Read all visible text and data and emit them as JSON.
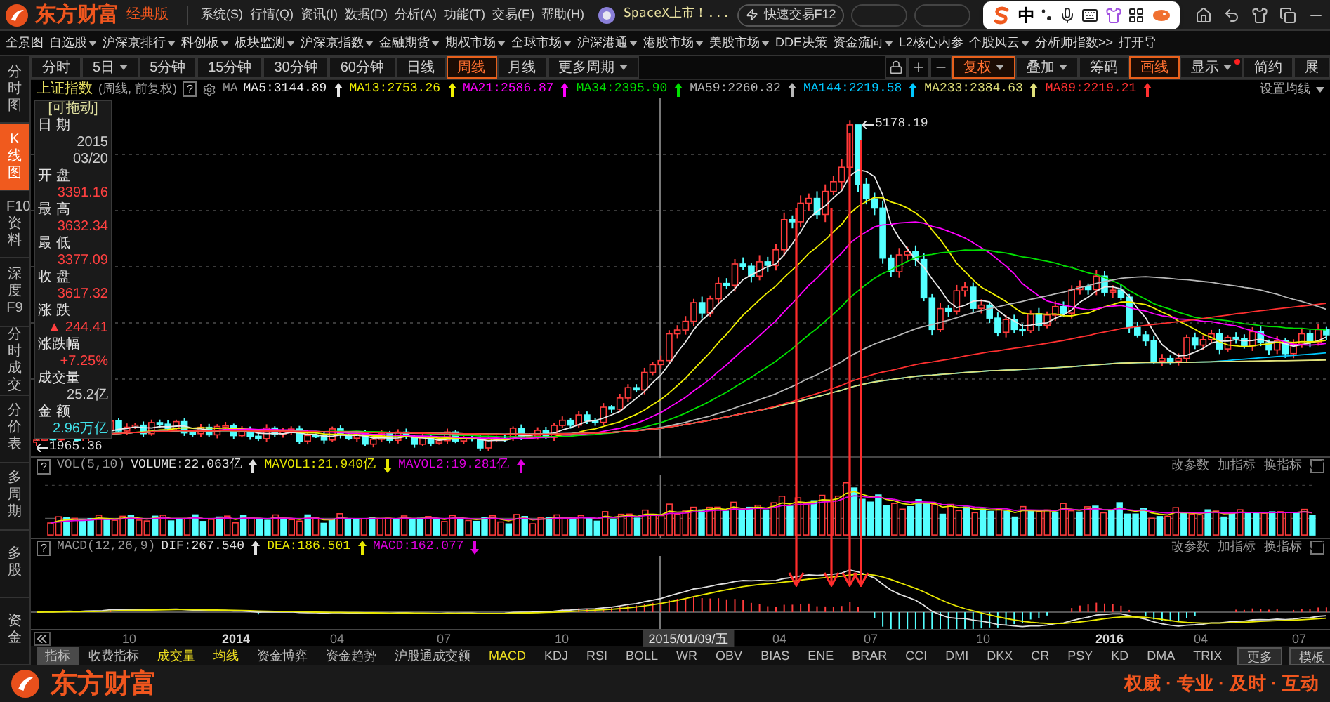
{
  "title_bar": {
    "logo": "东方财富",
    "edition": "经典版",
    "menus": [
      "系统(S)",
      "行情(Q)",
      "资讯(I)",
      "数据(D)",
      "分析(A)",
      "功能(T)",
      "交易(E)",
      "帮助(H)"
    ],
    "news": "SpaceX上市！...",
    "quick_trade": "快速交易F12",
    "ime": {
      "label": "中"
    }
  },
  "nav": [
    {
      "label": "全景图",
      "dropdown": false
    },
    {
      "label": "自选股",
      "dropdown": true
    },
    {
      "label": "沪深京排行",
      "dropdown": true
    },
    {
      "label": "科创板",
      "dropdown": true
    },
    {
      "label": "板块监测",
      "dropdown": true
    },
    {
      "label": "沪深京指数",
      "dropdown": true
    },
    {
      "label": "金融期货",
      "dropdown": true
    },
    {
      "label": "期权市场",
      "dropdown": true
    },
    {
      "label": "全球市场",
      "dropdown": true
    },
    {
      "label": "沪深港通",
      "dropdown": true
    },
    {
      "label": "港股市场",
      "dropdown": true
    },
    {
      "label": "美股市场",
      "dropdown": true
    },
    {
      "label": "DDE决策",
      "dropdown": false
    },
    {
      "label": "资金流向",
      "dropdown": true
    },
    {
      "label": "L2核心内参",
      "dropdown": false
    },
    {
      "label": "个股风云",
      "dropdown": true
    },
    {
      "label": "分析师指数>>",
      "dropdown": false
    },
    {
      "label": "打开导",
      "dropdown": false
    }
  ],
  "sidebar": [
    {
      "label": "分时图",
      "selected": false
    },
    {
      "label": "K线图",
      "selected": true
    },
    {
      "label": "F10资料",
      "selected": false
    },
    {
      "label": "深度F9",
      "selected": false
    },
    {
      "label": "分时成交",
      "selected": false
    },
    {
      "label": "分价表",
      "selected": false
    },
    {
      "label": "多周期",
      "selected": false
    },
    {
      "label": "多股",
      "selected": false
    },
    {
      "label": "资金",
      "selected": false
    }
  ],
  "periods": [
    {
      "label": "分时",
      "dropdown": false,
      "selected": false
    },
    {
      "label": "5日",
      "dropdown": true,
      "selected": false
    },
    {
      "label": "5分钟",
      "dropdown": false,
      "selected": false
    },
    {
      "label": "15分钟",
      "dropdown": false,
      "selected": false
    },
    {
      "label": "30分钟",
      "dropdown": false,
      "selected": false
    },
    {
      "label": "60分钟",
      "dropdown": false,
      "selected": false
    },
    {
      "label": "日线",
      "dropdown": false,
      "selected": false
    },
    {
      "label": "周线",
      "dropdown": false,
      "selected": true
    },
    {
      "label": "月线",
      "dropdown": false,
      "selected": false
    },
    {
      "label": "更多周期",
      "dropdown": true,
      "selected": false
    }
  ],
  "toolbar": [
    {
      "label": "复权",
      "dropdown": true,
      "active": true,
      "dot": false
    },
    {
      "label": "叠加",
      "dropdown": true,
      "active": false,
      "dot": false
    },
    {
      "label": "筹码",
      "dropdown": false,
      "active": false,
      "dot": false
    },
    {
      "label": "画线",
      "dropdown": false,
      "active": true,
      "dot": false
    },
    {
      "label": "显示",
      "dropdown": true,
      "active": false,
      "dot": true
    },
    {
      "label": "简约",
      "dropdown": false,
      "active": false,
      "dot": false
    },
    {
      "label": "展",
      "dropdown": false,
      "active": false,
      "dot": false
    }
  ],
  "legend": {
    "title": "上证指数",
    "subtitle": "(周线, 前复权)",
    "help": "?",
    "ma_prefix": "MA",
    "settings": "设置均线",
    "mas": [
      {
        "label": "MA5:3144.89",
        "color": "#e8e8e8",
        "rising": true
      },
      {
        "label": "MA13:2753.26",
        "color": "#f0f000",
        "rising": true
      },
      {
        "label": "MA21:2586.87",
        "color": "#ff00ff",
        "rising": true
      },
      {
        "label": "MA34:2395.90",
        "color": "#00e000",
        "rising": true
      },
      {
        "label": "MA59:2260.32",
        "color": "#b8b8b8",
        "rising": true
      },
      {
        "label": "MA144:2219.58",
        "color": "#00c8ff",
        "rising": true
      },
      {
        "label": "MA233:2384.63",
        "color": "#e0e07a",
        "rising": true
      },
      {
        "label": "MA89:2219.21",
        "color": "#ff3030",
        "rising": true
      }
    ]
  },
  "info_panel": {
    "title": "[可拖动]",
    "fields": [
      {
        "label": "日 期",
        "values": [
          "2015",
          "03/20"
        ],
        "kind": "plain"
      },
      {
        "label": "开 盘",
        "values": [
          "3391.16"
        ],
        "kind": "up"
      },
      {
        "label": "最 高",
        "values": [
          "3632.34"
        ],
        "kind": "up"
      },
      {
        "label": "最 低",
        "values": [
          "3377.09"
        ],
        "kind": "up"
      },
      {
        "label": "收 盘",
        "values": [
          "3617.32"
        ],
        "kind": "up"
      },
      {
        "label": "涨 跌",
        "values": [
          "▲ 244.41"
        ],
        "kind": "up"
      },
      {
        "label": "涨跌幅",
        "values": [
          "+7.25%"
        ],
        "kind": "up"
      },
      {
        "label": "成交量",
        "values": [
          "25.2亿"
        ],
        "kind": "plain"
      },
      {
        "label": "金 额",
        "values": [
          "2.96万亿"
        ],
        "kind": "amount"
      }
    ]
  },
  "price_labels": {
    "high": "5178.19",
    "low": "1965.36"
  },
  "indicators": [
    {
      "kind": "volume",
      "help": "?",
      "name": "VOL(5,10)",
      "actions": [
        "改参数",
        "加指标",
        "换指标"
      ],
      "items": [
        {
          "label": "VOLUME:22.063亿",
          "color": "#e0e0e0",
          "rising": true
        },
        {
          "label": "MAVOL1:21.940亿",
          "color": "#e8e800",
          "rising": false
        },
        {
          "label": "MAVOL2:19.281亿",
          "color": "#e000e0",
          "rising": true
        }
      ]
    },
    {
      "kind": "macd",
      "help": "?",
      "name": "MACD(12,26,9)",
      "actions": [
        "改参数",
        "加指标",
        "换指标"
      ],
      "items": [
        {
          "label": "DIF:267.540",
          "color": "#e0e0e0",
          "rising": true
        },
        {
          "label": "DEA:186.501",
          "color": "#e8e800",
          "rising": true
        },
        {
          "label": "MACD:162.077",
          "color": "#e000e0",
          "rising": false
        }
      ]
    }
  ],
  "time_axis": [
    {
      "label": "10",
      "highlighted": false,
      "year": false
    },
    {
      "label": "2014",
      "highlighted": false,
      "year": true
    },
    {
      "label": "04",
      "highlighted": false,
      "year": false
    },
    {
      "label": "07",
      "highlighted": false,
      "year": false
    },
    {
      "label": "10",
      "highlighted": false,
      "year": false
    },
    {
      "label": "2015/01/09/五",
      "highlighted": true,
      "year": false
    },
    {
      "label": "04",
      "highlighted": false,
      "year": false
    },
    {
      "label": "07",
      "highlighted": false,
      "year": false
    },
    {
      "label": "10",
      "highlighted": false,
      "year": false
    },
    {
      "label": "2016",
      "highlighted": false,
      "year": true
    },
    {
      "label": "04",
      "highlighted": false,
      "year": false
    },
    {
      "label": "07",
      "highlighted": false,
      "year": false
    }
  ],
  "indicator_tabs": [
    {
      "label": "指标",
      "selected": true,
      "accent": false,
      "kind": "tab"
    },
    {
      "label": "收费指标",
      "selected": false,
      "accent": false,
      "kind": "tab"
    },
    {
      "label": "成交量",
      "selected": false,
      "accent": true,
      "kind": "tab"
    },
    {
      "label": "均线",
      "selected": false,
      "accent": true,
      "kind": "tab"
    },
    {
      "label": "资金博弈",
      "selected": false,
      "accent": false,
      "kind": "tab"
    },
    {
      "label": "资金趋势",
      "selected": false,
      "accent": false,
      "kind": "tab"
    },
    {
      "label": "沪股通成交额",
      "selected": false,
      "accent": false,
      "kind": "tab"
    },
    {
      "label": "MACD",
      "selected": false,
      "accent": true,
      "kind": "tab"
    },
    {
      "label": "KDJ",
      "selected": false,
      "accent": false,
      "kind": "tab"
    },
    {
      "label": "RSI",
      "selected": false,
      "accent": false,
      "kind": "tab"
    },
    {
      "label": "BOLL",
      "selected": false,
      "accent": false,
      "kind": "tab"
    },
    {
      "label": "WR",
      "selected": false,
      "accent": false,
      "kind": "tab"
    },
    {
      "label": "OBV",
      "selected": false,
      "accent": false,
      "kind": "tab"
    },
    {
      "label": "BIAS",
      "selected": false,
      "accent": false,
      "kind": "tab"
    },
    {
      "label": "ENE",
      "selected": false,
      "accent": false,
      "kind": "tab"
    },
    {
      "label": "BRAR",
      "selected": false,
      "accent": false,
      "kind": "tab"
    },
    {
      "label": "CCI",
      "selected": false,
      "accent": false,
      "kind": "tab"
    },
    {
      "label": "DMI",
      "selected": false,
      "accent": false,
      "kind": "tab"
    },
    {
      "label": "DKX",
      "selected": false,
      "accent": false,
      "kind": "tab"
    },
    {
      "label": "CR",
      "selected": false,
      "accent": false,
      "kind": "tab"
    },
    {
      "label": "PSY",
      "selected": false,
      "accent": false,
      "kind": "tab"
    },
    {
      "label": "KD",
      "selected": false,
      "accent": false,
      "kind": "tab"
    },
    {
      "label": "DMA",
      "selected": false,
      "accent": false,
      "kind": "tab"
    },
    {
      "label": "TRIX",
      "selected": false,
      "accent": false,
      "kind": "tab"
    },
    {
      "label": "更多",
      "selected": false,
      "accent": false,
      "kind": "button"
    },
    {
      "label": "模板",
      "selected": false,
      "accent": false,
      "kind": "button"
    }
  ],
  "banner": {
    "logo": "东方财富",
    "slogan": "权威 · 专业 · 及时 · 互动"
  }
}
